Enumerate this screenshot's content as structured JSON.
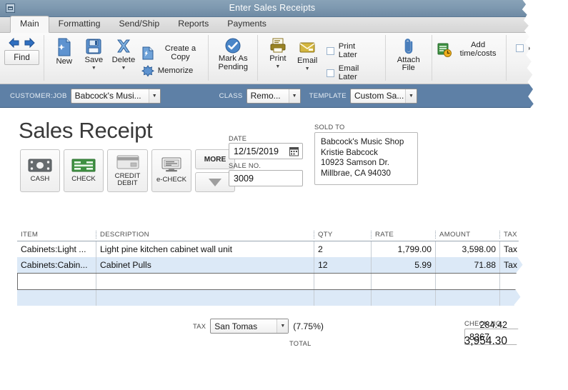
{
  "window": {
    "title": "Enter Sales Receipts",
    "system_menu_icon": "restore-icon"
  },
  "ribbon": {
    "tabs": [
      {
        "label": "Main",
        "active": true
      },
      {
        "label": "Formatting",
        "active": false
      },
      {
        "label": "Send/Ship",
        "active": false
      },
      {
        "label": "Reports",
        "active": false
      },
      {
        "label": "Payments",
        "active": false
      }
    ],
    "find_label": "Find",
    "back_icon": "arrow-left-icon",
    "forward_icon": "arrow-right-icon",
    "items": [
      {
        "label": "New",
        "icon": "new-document-icon",
        "has_caret": false
      },
      {
        "label": "Save",
        "icon": "save-disk-icon",
        "has_caret": true
      },
      {
        "label": "Delete",
        "icon": "delete-x-icon",
        "has_caret": true
      },
      {
        "label": "Create a Copy",
        "icon": "copy-icon"
      },
      {
        "label": "Memorize",
        "icon": "memorize-icon"
      },
      {
        "label": "Mark As Pending",
        "icon": "checkmark-icon"
      },
      {
        "label": "Print",
        "icon": "printer-icon",
        "has_caret": true
      },
      {
        "label": "Email",
        "icon": "envelope-icon",
        "has_caret": true
      },
      {
        "label": "Attach File",
        "icon": "paperclip-icon"
      },
      {
        "label": "Add time/costs",
        "icon": "add-time-costs-icon"
      }
    ],
    "checkboxes": [
      {
        "label": "Print Later",
        "checked": false
      },
      {
        "label": "Email Later",
        "checked": false
      }
    ],
    "cut_off_checkbox_label": "P"
  },
  "header_bar": {
    "customer_job_label": "CUSTOMER:JOB",
    "customer_job_value": "Babcock's Musi...",
    "class_label": "CLASS",
    "class_value": "Remo...",
    "template_label": "TEMPLATE",
    "template_value": "Custom Sa..."
  },
  "form": {
    "doc_title": "Sales Receipt",
    "payment_methods": [
      {
        "label": "CASH",
        "icon": "cash-icon",
        "selected": false
      },
      {
        "label": "CHECK",
        "icon": "check-icon",
        "selected": true
      },
      {
        "label": "CREDIT DEBIT",
        "icon": "credit-card-icon",
        "selected": false
      },
      {
        "label": "e-CHECK",
        "icon": "e-check-icon",
        "selected": false
      }
    ],
    "more_label": "MORE",
    "more_dropdown_icon": "triangle-down-icon",
    "date_label": "DATE",
    "date_value": "12/15/2019",
    "calendar_icon": "calendar-icon",
    "sale_no_label": "SALE NO.",
    "sale_no_value": "3009",
    "sold_to_label": "SOLD TO",
    "sold_to_lines": [
      "Babcock's Music Shop",
      "Kristie Babcock",
      "10923 Samson Dr.",
      "Millbrae, CA 94030"
    ],
    "check_no_label": "CHECK NO.",
    "check_no_value": "8367"
  },
  "line_items": {
    "columns": [
      "ITEM",
      "DESCRIPTION",
      "QTY",
      "RATE",
      "AMOUNT",
      "TAX"
    ],
    "rows": [
      {
        "item": "Cabinets:Light ...",
        "description": "Light pine kitchen cabinet wall unit",
        "qty": "2",
        "rate": "1,799.00",
        "amount": "3,598.00",
        "tax": "Tax"
      },
      {
        "item": "Cabinets:Cabin...",
        "description": "Cabinet Pulls",
        "qty": "12",
        "rate": "5.99",
        "amount": "71.88",
        "tax": "Tax"
      },
      {
        "item": "",
        "description": "",
        "qty": "",
        "rate": "",
        "amount": "",
        "tax": ""
      },
      {
        "item": "",
        "description": "",
        "qty": "",
        "rate": "",
        "amount": "",
        "tax": ""
      }
    ],
    "scrollbar": {
      "up_icon": "scroll-up-icon",
      "down_icon": "scroll-down-icon"
    }
  },
  "totals": {
    "tax_label": "TAX",
    "tax_code_value": "San Tomas",
    "tax_rate_text": "(7.75%)",
    "tax_amount": "284.42",
    "total_label": "TOTAL",
    "total_amount": "3,954.30"
  },
  "colors": {
    "titlebar": "#7e99b0",
    "customer_bar": "#5e80a6",
    "selected_payment": "#3f9142",
    "row_alt": "#dce9f7",
    "ribbon_icon_blue": "#4a7ebb",
    "ribbon_icon_gold": "#9a8324"
  }
}
